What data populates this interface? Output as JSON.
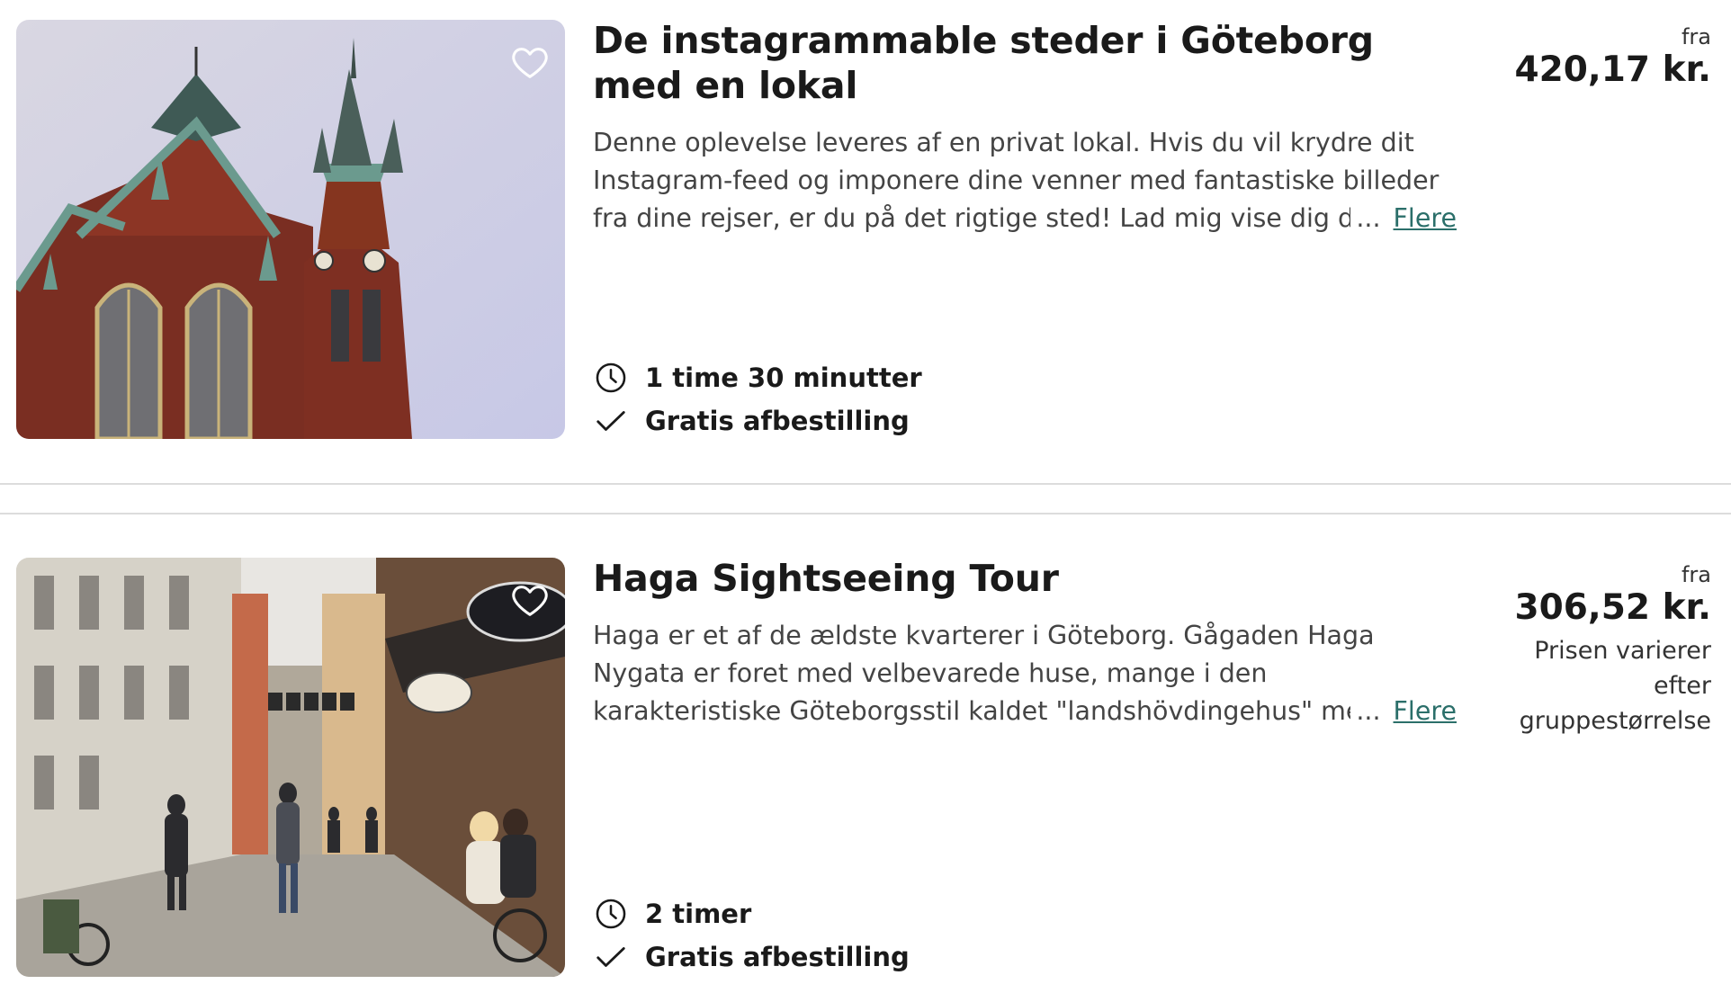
{
  "listings": [
    {
      "title": "De instagrammable steder i Göteborg med en lokal",
      "description": "Denne oplevelse leveres af en privat lokal. Hvis du vil krydre dit Instagram-feed og imponere dine venner med fantastiske billeder fra dine rejser, er du på det rigtige sted! Lad mig vise dig de",
      "ellipsis": "...",
      "more_label": "Flere",
      "duration": "1 time 30 minutter",
      "cancellation": "Gratis afbestilling",
      "price_prefix": "fra",
      "price": "420,17 kr.",
      "price_note": "",
      "image_icon": "church-photo",
      "favorite_icon": "heart-outline-icon"
    },
    {
      "title": "Haga Sightseeing Tour",
      "description": "Haga er et af de ældste kvarterer i Göteborg. Gågaden Haga Nygata er foret med velbevarede huse, mange i den karakteristiske Göteborgsstil kaldet \"landshövdingehus\" med en etage i mur",
      "ellipsis": "...",
      "more_label": "Flere",
      "duration": "2 timer",
      "cancellation": "Gratis afbestilling",
      "price_prefix": "fra",
      "price": "306,52 kr.",
      "price_note": "Prisen varierer efter gruppestørrelse",
      "image_icon": "haga-street-photo",
      "favorite_icon": "heart-outline-icon"
    }
  ],
  "colors": {
    "link": "#2b6f6a",
    "text": "#1a1a1a",
    "muted": "#444444",
    "divider": "#dcdcdc"
  }
}
